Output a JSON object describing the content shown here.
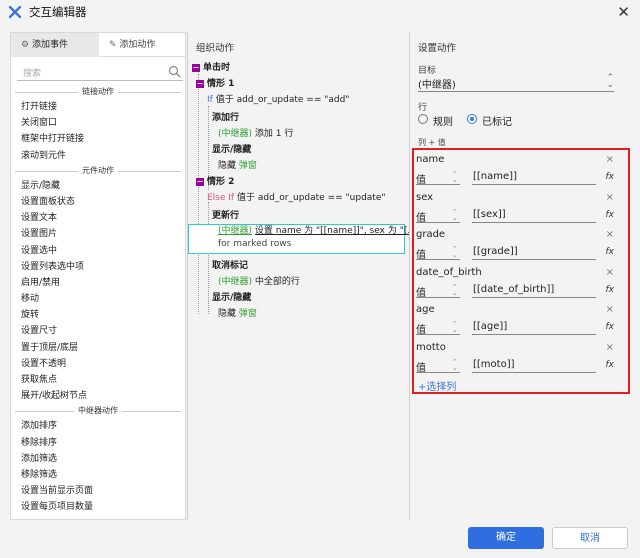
{
  "window": {
    "title": "交互编辑器",
    "close": "✕"
  },
  "left": {
    "tabs": [
      "添加事件",
      "添加动作"
    ],
    "search_placeholder": "搜索",
    "groups": [
      {
        "title": "链接动作",
        "items": [
          "打开链接",
          "关闭窗口",
          "框架中打开链接",
          "滚动到元件"
        ]
      },
      {
        "title": "元件动作",
        "items": [
          "显示/隐藏",
          "设置面板状态",
          "设置文本",
          "设置图片",
          "设置选中",
          "设置列表选中项",
          "启用/禁用",
          "移动",
          "旋转",
          "设置尺寸",
          "置于顶层/底层",
          "设置不透明",
          "获取焦点",
          "展开/收起树节点"
        ]
      },
      {
        "title": "中继器动作",
        "items": [
          "添加排序",
          "移除排序",
          "添加筛选",
          "移除筛选",
          "设置当前显示页面",
          "设置每页项目数量"
        ]
      }
    ]
  },
  "middle": {
    "header": "组织动作",
    "event": "单击时",
    "case1": {
      "label": "情形 1",
      "cond_kw": "If",
      "cond": "值于 add_or_update == \"add\"",
      "a1_title": "添加行",
      "a1_el": "(中继器)",
      "a1_text": "添加 1 行",
      "a2_title": "显示/隐藏",
      "a2_text": "隐藏",
      "a2_el": "弹窗"
    },
    "case2": {
      "label": "情形 2",
      "cond_kw": "Else If",
      "cond": "值于 add_or_update == \"update\"",
      "a1_title": "更新行",
      "a1_el": "(中继器)",
      "a1_text": "设置 name 为 \"[[name]]\", sex 为 \"[...",
      "a1_text2": "for marked rows",
      "a2_title": "取消标记",
      "a2_el": "(中继器)",
      "a2_text": "中全部的行",
      "a3_title": "显示/隐藏",
      "a3_text": "隐藏",
      "a3_el": "弹窗"
    }
  },
  "right": {
    "header": "设置动作",
    "target_label": "目标",
    "target_value": "(中继器)",
    "row_label": "行",
    "radio_rule": "规则",
    "radio_marked": "已标记",
    "colval_label": "列 + 值",
    "entries": [
      {
        "name": "name",
        "type": "值",
        "value": "[[name]]"
      },
      {
        "name": "sex",
        "type": "值",
        "value": "[[sex]]"
      },
      {
        "name": "grade",
        "type": "值",
        "value": "[[grade]]"
      },
      {
        "name": "date_of_birth",
        "type": "值",
        "value": "[[date_of_birth]]"
      },
      {
        "name": "age",
        "type": "值",
        "value": "[[age]]"
      },
      {
        "name": "motto",
        "type": "值",
        "value": "[[moto]]"
      }
    ],
    "add_column": "+选择列",
    "fx": "fx",
    "remove": "×"
  },
  "footer": {
    "ok": "确定",
    "cancel": "取消"
  },
  "colors": {
    "accent": "#2f6ee0",
    "highlight": "#2ec9d9",
    "red_box": "#e02020",
    "element_green": "#2e9e2e",
    "case_purple": "#a100a1"
  }
}
